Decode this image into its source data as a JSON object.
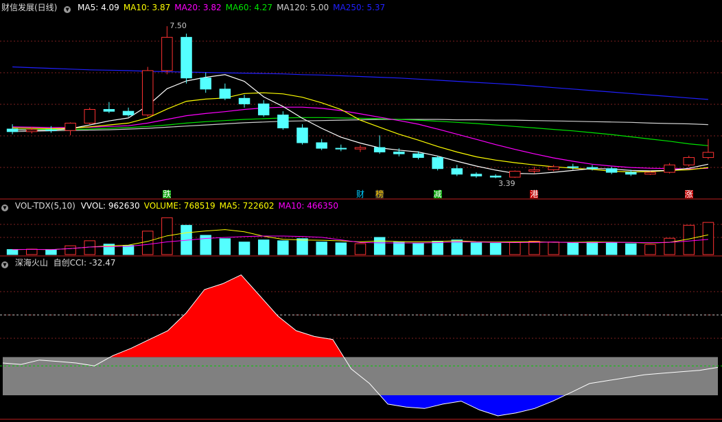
{
  "colors": {
    "bg": "#000000",
    "up": "#ff3232",
    "down": "#54ffff",
    "grid": "#802020",
    "ma5": "#ffffff",
    "ma10": "#ffff00",
    "ma20": "#ff00ff",
    "ma60": "#00e600",
    "ma120": "#d0d0d0",
    "ma250": "#2020ff",
    "cci_pos": "#ff0000",
    "cci_neg": "#0000ff",
    "band": "#808080"
  },
  "price_panel": {
    "title": "财信发展(日线)",
    "ma": [
      {
        "label": "MA5: 4.09",
        "color": "#ffffff"
      },
      {
        "label": "MA10: 3.87",
        "color": "#ffff00"
      },
      {
        "label": "MA20: 3.82",
        "color": "#ff00ff"
      },
      {
        "label": "MA60: 4.27",
        "color": "#00e600"
      },
      {
        "label": "MA120: 5.00",
        "color": "#d0d0d0"
      },
      {
        "label": "MA250: 5.37",
        "color": "#2020ff"
      }
    ],
    "high_label": "7.50",
    "low_label": "3.39",
    "tags": [
      {
        "text": "跌",
        "color": "#ffffff",
        "bg": "#00a000",
        "idx": 8
      },
      {
        "text": "财",
        "color": "#00ccff",
        "bg": "#000000",
        "idx": 18
      },
      {
        "text": "榜",
        "color": "#ffcc00",
        "bg": "#303030",
        "idx": 19
      },
      {
        "text": "减",
        "color": "#ffffff",
        "bg": "#00a000",
        "idx": 22
      },
      {
        "text": "港",
        "color": "#ffffff",
        "bg": "#c00000",
        "idx": 27
      },
      {
        "text": "涨",
        "color": "#ffffff",
        "bg": "#c00000",
        "idx": 35
      }
    ]
  },
  "volume_panel": {
    "title": "VOL-TDX(5,10)",
    "items": [
      {
        "label": "VVOL: 962630",
        "color": "#ffffff"
      },
      {
        "label": "VOLUME: 768519",
        "color": "#ffff00"
      },
      {
        "label": "MA5: 722602",
        "color": "#ffff00"
      },
      {
        "label": "MA10: 466350",
        "color": "#ff00ff"
      }
    ]
  },
  "cci_panel": {
    "title": "深海火山",
    "label": "自创CCI: -32.47"
  },
  "chart_data": [
    {
      "type": "candlestick",
      "title": "财信发展(日线)",
      "ylim": [
        3.2,
        7.8
      ],
      "x": [
        1,
        2,
        3,
        4,
        5,
        6,
        7,
        8,
        9,
        10,
        11,
        12,
        13,
        14,
        15,
        16,
        17,
        18,
        19,
        20,
        21,
        22,
        23,
        24,
        25,
        26,
        27,
        28,
        29,
        30,
        31,
        32,
        33,
        34,
        35,
        36,
        37
      ],
      "candles": [
        {
          "o": 4.72,
          "h": 4.85,
          "l": 4.58,
          "c": 4.65
        },
        {
          "o": 4.65,
          "h": 4.78,
          "l": 4.6,
          "c": 4.7
        },
        {
          "o": 4.7,
          "h": 4.8,
          "l": 4.62,
          "c": 4.68
        },
        {
          "o": 4.68,
          "h": 4.9,
          "l": 4.55,
          "c": 4.88
        },
        {
          "o": 4.88,
          "h": 5.3,
          "l": 4.85,
          "c": 5.25
        },
        {
          "o": 5.25,
          "h": 5.45,
          "l": 5.15,
          "c": 5.2
        },
        {
          "o": 5.2,
          "h": 5.3,
          "l": 5.05,
          "c": 5.1
        },
        {
          "o": 5.1,
          "h": 6.4,
          "l": 5.05,
          "c": 6.3
        },
        {
          "o": 6.3,
          "h": 7.5,
          "l": 6.2,
          "c": 7.2
        },
        {
          "o": 7.2,
          "h": 7.3,
          "l": 5.95,
          "c": 6.1
        },
        {
          "o": 6.1,
          "h": 6.25,
          "l": 5.7,
          "c": 5.8
        },
        {
          "o": 5.8,
          "h": 5.95,
          "l": 5.5,
          "c": 5.55
        },
        {
          "o": 5.55,
          "h": 5.65,
          "l": 5.3,
          "c": 5.4
        },
        {
          "o": 5.4,
          "h": 5.5,
          "l": 5.05,
          "c": 5.1
        },
        {
          "o": 5.1,
          "h": 5.2,
          "l": 4.7,
          "c": 4.75
        },
        {
          "o": 4.75,
          "h": 4.85,
          "l": 4.3,
          "c": 4.35
        },
        {
          "o": 4.35,
          "h": 4.45,
          "l": 4.15,
          "c": 4.2
        },
        {
          "o": 4.2,
          "h": 4.3,
          "l": 4.12,
          "c": 4.18
        },
        {
          "o": 4.18,
          "h": 4.28,
          "l": 4.1,
          "c": 4.22
        },
        {
          "o": 4.22,
          "h": 4.55,
          "l": 4.05,
          "c": 4.1
        },
        {
          "o": 4.1,
          "h": 4.2,
          "l": 3.98,
          "c": 4.05
        },
        {
          "o": 4.05,
          "h": 4.12,
          "l": 3.9,
          "c": 3.95
        },
        {
          "o": 3.95,
          "h": 4.0,
          "l": 3.6,
          "c": 3.65
        },
        {
          "o": 3.65,
          "h": 3.75,
          "l": 3.45,
          "c": 3.5
        },
        {
          "o": 3.5,
          "h": 3.55,
          "l": 3.4,
          "c": 3.45
        },
        {
          "o": 3.45,
          "h": 3.5,
          "l": 3.39,
          "c": 3.42
        },
        {
          "o": 3.42,
          "h": 3.6,
          "l": 3.4,
          "c": 3.58
        },
        {
          "o": 3.58,
          "h": 3.7,
          "l": 3.52,
          "c": 3.62
        },
        {
          "o": 3.62,
          "h": 3.75,
          "l": 3.58,
          "c": 3.7
        },
        {
          "o": 3.7,
          "h": 3.78,
          "l": 3.62,
          "c": 3.68
        },
        {
          "o": 3.68,
          "h": 3.75,
          "l": 3.6,
          "c": 3.65
        },
        {
          "o": 3.65,
          "h": 3.7,
          "l": 3.5,
          "c": 3.55
        },
        {
          "o": 3.55,
          "h": 3.62,
          "l": 3.45,
          "c": 3.5
        },
        {
          "o": 3.5,
          "h": 3.58,
          "l": 3.48,
          "c": 3.55
        },
        {
          "o": 3.55,
          "h": 3.8,
          "l": 3.52,
          "c": 3.75
        },
        {
          "o": 3.75,
          "h": 4.0,
          "l": 3.7,
          "c": 3.95
        },
        {
          "o": 3.95,
          "h": 4.45,
          "l": 3.9,
          "c": 4.09
        }
      ],
      "ma5": [
        4.7,
        4.69,
        4.69,
        4.73,
        4.83,
        4.94,
        5.02,
        5.35,
        5.81,
        6.02,
        6.12,
        6.19,
        6.01,
        5.59,
        5.33,
        5.01,
        4.74,
        4.5,
        4.34,
        4.21,
        4.15,
        4.1,
        3.99,
        3.85,
        3.72,
        3.61,
        3.52,
        3.51,
        3.55,
        3.6,
        3.65,
        3.64,
        3.6,
        3.59,
        3.6,
        3.66,
        3.77
      ],
      "ma10": [
        4.75,
        4.74,
        4.73,
        4.74,
        4.78,
        4.83,
        4.88,
        5.02,
        5.26,
        5.47,
        5.53,
        5.56,
        5.68,
        5.7,
        5.67,
        5.58,
        5.43,
        5.25,
        4.96,
        4.77,
        4.58,
        4.42,
        4.25,
        4.1,
        3.97,
        3.88,
        3.81,
        3.75,
        3.7,
        3.66,
        3.63,
        3.58,
        3.56,
        3.57,
        3.6,
        3.62,
        3.68
      ],
      "ma20": [
        4.78,
        4.77,
        4.76,
        4.76,
        4.77,
        4.79,
        4.81,
        4.88,
        4.98,
        5.08,
        5.14,
        5.19,
        5.25,
        5.29,
        5.31,
        5.31,
        5.28,
        5.22,
        5.13,
        5.04,
        4.95,
        4.85,
        4.72,
        4.58,
        4.44,
        4.3,
        4.17,
        4.05,
        3.94,
        3.85,
        3.77,
        3.72,
        3.68,
        3.66,
        3.65,
        3.64,
        3.66
      ],
      "ma60": [
        4.7,
        4.7,
        4.71,
        4.71,
        4.72,
        4.74,
        4.76,
        4.79,
        4.83,
        4.88,
        4.92,
        4.95,
        4.98,
        5.0,
        5.02,
        5.03,
        5.03,
        5.02,
        5.01,
        5.0,
        4.98,
        4.96,
        4.93,
        4.9,
        4.87,
        4.83,
        4.79,
        4.75,
        4.71,
        4.67,
        4.62,
        4.57,
        4.51,
        4.45,
        4.39,
        4.32,
        4.27
      ],
      "ma120": [
        4.65,
        4.66,
        4.67,
        4.68,
        4.69,
        4.7,
        4.72,
        4.74,
        4.77,
        4.8,
        4.83,
        4.86,
        4.89,
        4.91,
        4.93,
        4.94,
        4.95,
        4.96,
        4.97,
        4.98,
        4.98,
        4.98,
        4.98,
        4.97,
        4.97,
        4.96,
        4.96,
        4.95,
        4.94,
        4.93,
        4.92,
        4.91,
        4.9,
        4.88,
        4.87,
        4.86,
        4.84
      ],
      "ma250": [
        6.4,
        6.38,
        6.36,
        6.34,
        6.32,
        6.31,
        6.3,
        6.28,
        6.27,
        6.26,
        6.25,
        6.24,
        6.23,
        6.22,
        6.21,
        6.19,
        6.18,
        6.16,
        6.14,
        6.12,
        6.1,
        6.07,
        6.04,
        6.01,
        5.98,
        5.95,
        5.92,
        5.88,
        5.84,
        5.8,
        5.76,
        5.72,
        5.68,
        5.64,
        5.6,
        5.56,
        5.52
      ]
    },
    {
      "type": "bar",
      "title": "VOL-TDX(5,10)",
      "ylim": [
        0,
        1000000
      ],
      "values": [
        120000,
        130000,
        110000,
        210000,
        330000,
        250000,
        220000,
        560000,
        880000,
        700000,
        460000,
        380000,
        300000,
        350000,
        330000,
        380000,
        300000,
        280000,
        260000,
        410000,
        300000,
        270000,
        320000,
        350000,
        280000,
        270000,
        300000,
        320000,
        300000,
        280000,
        300000,
        280000,
        260000,
        240000,
        390000,
        700000,
        768519
      ],
      "ma5": [
        120000,
        125000,
        120000,
        143000,
        180000,
        206000,
        224000,
        314000,
        448000,
        522000,
        564000,
        596000,
        544000,
        438000,
        364000,
        348000,
        342000,
        328000,
        304000,
        326000,
        310000,
        304000,
        312000,
        330000,
        306000,
        302000,
        304000,
        308000,
        294000,
        294000,
        300000,
        296000,
        288000,
        276000,
        294000,
        374000,
        471704
      ],
      "ma10": [
        120000,
        125000,
        120000,
        143000,
        180000,
        190000,
        196000,
        241000,
        304000,
        343000,
        385000,
        410000,
        429000,
        443000,
        443000,
        433000,
        411000,
        351000,
        289000,
        281000,
        278000,
        277000,
        286000,
        303000,
        299000,
        290000,
        287000,
        291000,
        300000,
        287000,
        285000,
        291000,
        290000,
        284000,
        293000,
        323000,
        362000
      ]
    },
    {
      "type": "area",
      "title": "深海火山",
      "ylim": [
        -200,
        300
      ],
      "values": [
        -20,
        -25,
        -10,
        -15,
        -20,
        -30,
        5,
        30,
        60,
        90,
        150,
        230,
        250,
        280,
        210,
        140,
        90,
        70,
        60,
        -40,
        -90,
        -160,
        -170,
        -175,
        -160,
        -150,
        -180,
        -200,
        -190,
        -175,
        -150,
        -120,
        -90,
        -80,
        -70,
        -60,
        -55,
        -50,
        -45,
        -35
      ],
      "band": [
        -130,
        0
      ]
    }
  ]
}
